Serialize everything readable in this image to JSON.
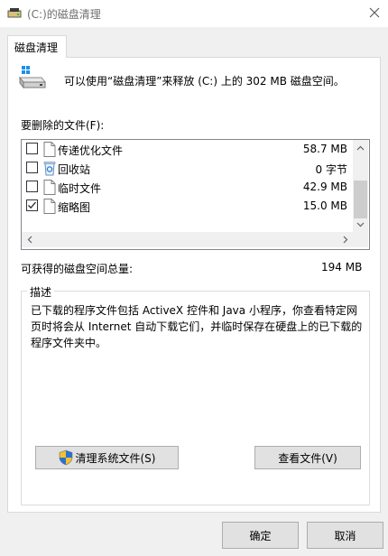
{
  "window": {
    "title": "(C:)的磁盘清理"
  },
  "tab": {
    "label": "磁盘清理"
  },
  "intro_text": "可以使用“磁盘清理”来释放 (C:) 上的 302 MB 磁盘空间。",
  "files_label": "要删除的文件(F):",
  "files": [
    {
      "name": "传递优化文件",
      "size": "58.7 MB",
      "checked": false,
      "icon": "file-icon"
    },
    {
      "name": "回收站",
      "size": "0 字节",
      "checked": false,
      "icon": "recycle-bin-icon"
    },
    {
      "name": "临时文件",
      "size": "42.9 MB",
      "checked": false,
      "icon": "file-icon"
    },
    {
      "name": "缩略图",
      "size": "15.0 MB",
      "checked": true,
      "icon": "file-icon"
    }
  ],
  "gain": {
    "label": "可获得的磁盘空间总量:",
    "value": "194 MB"
  },
  "description": {
    "legend": "描述",
    "text": "已下载的程序文件包括 ActiveX 控件和 Java 小程序，你查看特定网页时将会从 Internet 自动下载它们，并临时保存在硬盘上的已下载的程序文件夹中。"
  },
  "buttons": {
    "clean_system": "清理系统文件(S)",
    "view_files": "查看文件(V)",
    "ok": "确定",
    "cancel": "取消"
  },
  "icons": {
    "title": "disk-cleanup-icon",
    "drive": "drive-icon",
    "close": "close-icon",
    "shield": "uac-shield-icon"
  }
}
